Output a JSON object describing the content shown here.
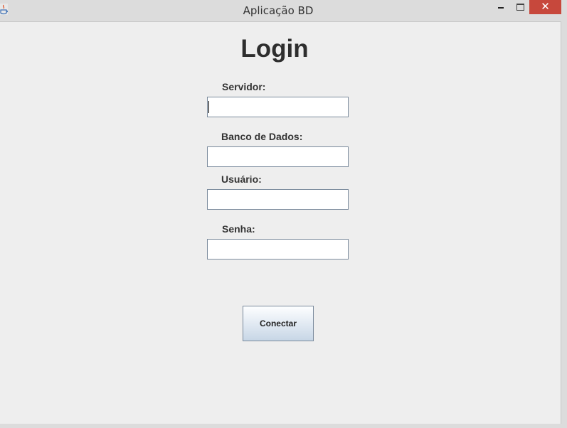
{
  "window": {
    "title": "Aplicação BD",
    "close_glyph": "✕",
    "colors": {
      "close_button": "#c7483c",
      "content_bg": "#eeeeee",
      "titlebar_bg": "#dcdcdc"
    }
  },
  "form": {
    "heading": "Login",
    "fields": [
      {
        "label": "Servidor:",
        "value": "",
        "focused": true
      },
      {
        "label": "Banco de Dados:",
        "value": ""
      },
      {
        "label": "Usuário:",
        "value": ""
      },
      {
        "label": "Senha:",
        "value": ""
      }
    ],
    "connect_label": "Conectar"
  }
}
